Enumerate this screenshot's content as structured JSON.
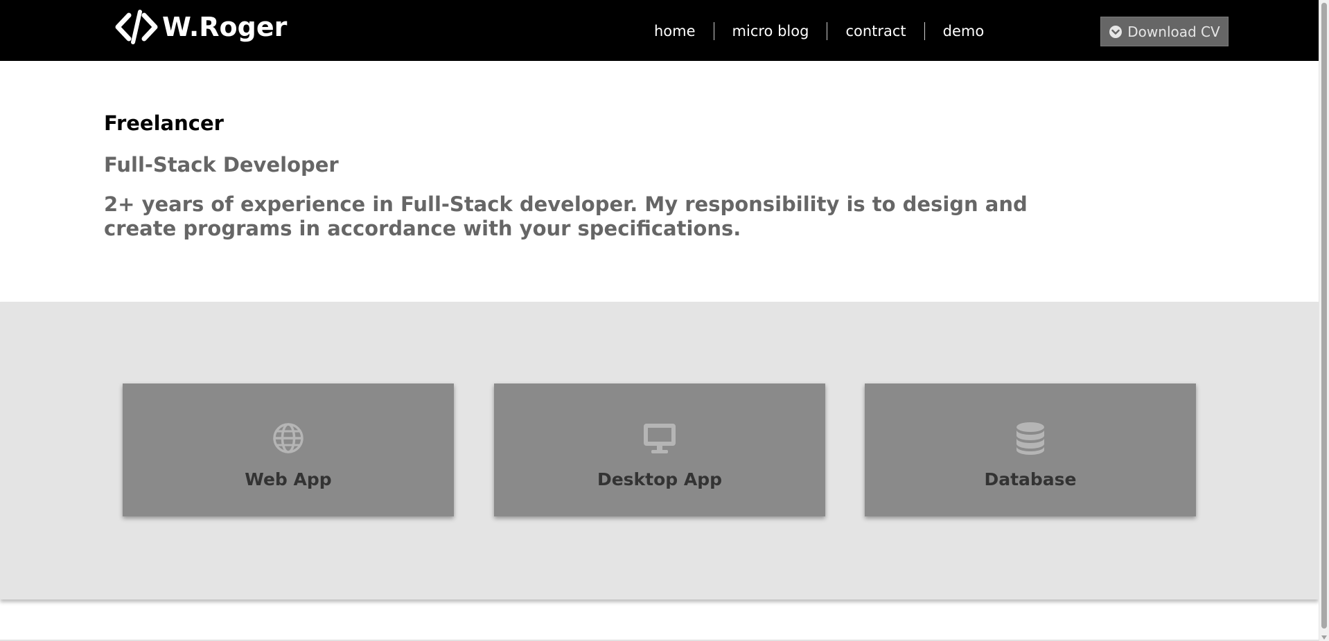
{
  "header": {
    "brand_name": "W.Roger",
    "brand_icon": "code-icon",
    "nav": [
      {
        "label": "home"
      },
      {
        "label": "micro blog"
      },
      {
        "label": "contract"
      },
      {
        "label": "demo"
      }
    ],
    "cv_button": {
      "label": "Download CV",
      "icon": "chevron-down-circle-icon"
    }
  },
  "intro": {
    "title": "Freelancer",
    "role": "Full-Stack Developer",
    "description": "2+ years of experience in Full-Stack developer. My responsibility is to design and create programs in accordance with your specifications."
  },
  "services": [
    {
      "label": "Web App",
      "icon": "globe-icon"
    },
    {
      "label": "Desktop App",
      "icon": "monitor-icon"
    },
    {
      "label": "Database",
      "icon": "database-icon"
    }
  ],
  "colors": {
    "navbar": "#000000",
    "button": "#666666",
    "section_bg": "#e4e4e4",
    "card_bg": "#8a8a8a",
    "muted_text": "#666666"
  }
}
